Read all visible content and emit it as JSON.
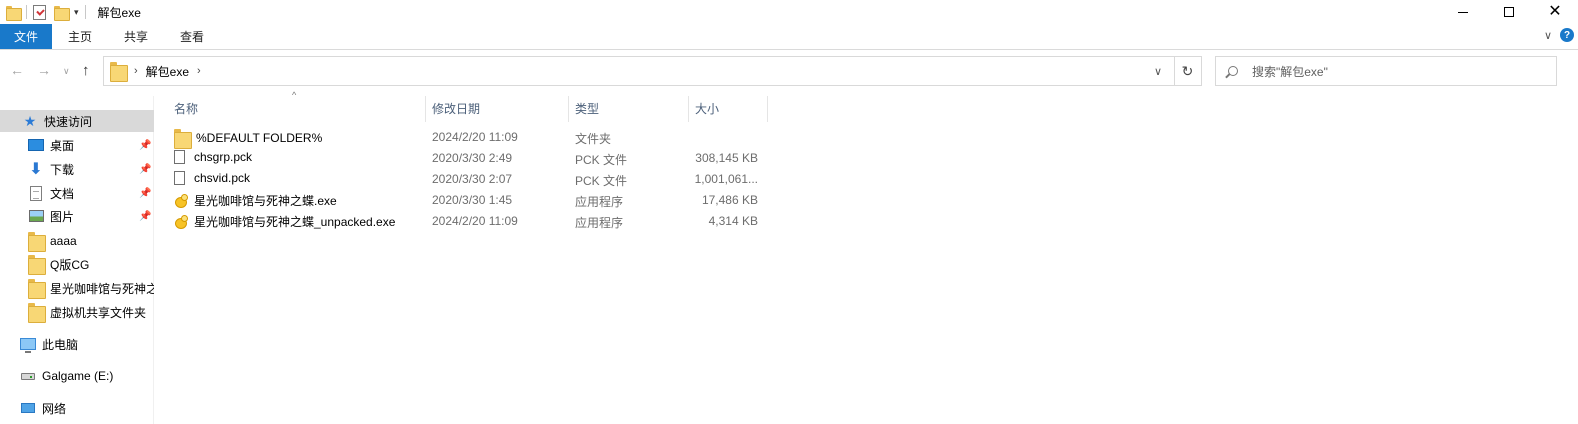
{
  "window": {
    "title": "解包exe"
  },
  "ribbon": {
    "tabs": [
      {
        "label": "文件"
      },
      {
        "label": "主页"
      },
      {
        "label": "共享"
      },
      {
        "label": "查看"
      }
    ]
  },
  "address": {
    "crumbs": [
      "解包exe"
    ]
  },
  "search": {
    "placeholder": "搜索\"解包exe\""
  },
  "sidebar": {
    "items": [
      {
        "label": "快速访问",
        "icon": "star-icon"
      },
      {
        "label": "桌面",
        "icon": "desktop-icon",
        "pinned": true
      },
      {
        "label": "下载",
        "icon": "download-icon",
        "pinned": true
      },
      {
        "label": "文档",
        "icon": "document-icon",
        "pinned": true
      },
      {
        "label": "图片",
        "icon": "picture-icon",
        "pinned": true
      },
      {
        "label": "aaaa",
        "icon": "folder-icon"
      },
      {
        "label": "Q版CG",
        "icon": "folder-icon"
      },
      {
        "label": "星光咖啡馆与死神之",
        "icon": "folder-icon"
      },
      {
        "label": "虚拟机共享文件夹",
        "icon": "folder-icon"
      },
      {
        "label": "此电脑",
        "icon": "computer-icon"
      },
      {
        "label": "Galgame (E:)",
        "icon": "drive-icon"
      },
      {
        "label": "网络",
        "icon": "network-icon"
      }
    ]
  },
  "filelist": {
    "columns": {
      "name": "名称",
      "date": "修改日期",
      "type": "类型",
      "size": "大小"
    },
    "rows": [
      {
        "name": "%DEFAULT FOLDER%",
        "date": "2024/2/20 11:09",
        "type": "文件夹",
        "size": "",
        "icon": "folder-icon"
      },
      {
        "name": "chsgrp.pck",
        "date": "2020/3/30 2:49",
        "type": "PCK 文件",
        "size": "308,145 KB",
        "icon": "file-icon"
      },
      {
        "name": "chsvid.pck",
        "date": "2020/3/30 2:07",
        "type": "PCK 文件",
        "size": "1,001,061...",
        "icon": "file-icon"
      },
      {
        "name": "星光咖啡馆与死神之蝶.exe",
        "date": "2020/3/30 1:45",
        "type": "应用程序",
        "size": "17,486 KB",
        "icon": "app-icon"
      },
      {
        "name": "星光咖啡馆与死神之蝶_unpacked.exe",
        "date": "2024/2/20 11:09",
        "type": "应用程序",
        "size": "4,314 KB",
        "icon": "app-icon"
      }
    ]
  }
}
